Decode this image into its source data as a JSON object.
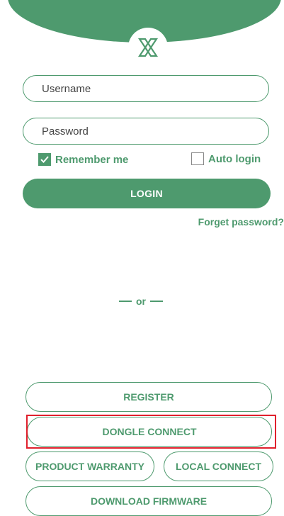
{
  "colors": {
    "brand": "#4e9a6e",
    "highlight": "#e0202c"
  },
  "header": {
    "logo_icon": "x-logo-icon"
  },
  "login_form": {
    "username_placeholder": "Username",
    "password_placeholder": "Password",
    "remember_me": {
      "label": "Remember me",
      "checked": true
    },
    "auto_login": {
      "label": "Auto login",
      "checked": false
    },
    "login_label": "LOGIN",
    "forget_password": "Forget password?"
  },
  "divider": {
    "text": "or"
  },
  "actions": {
    "register": "REGISTER",
    "dongle_connect": "DONGLE CONNECT",
    "product_warranty": "PRODUCT WARRANTY",
    "local_connect": "LOCAL CONNECT",
    "download_firmware": "DOWNLOAD FIRMWARE"
  }
}
